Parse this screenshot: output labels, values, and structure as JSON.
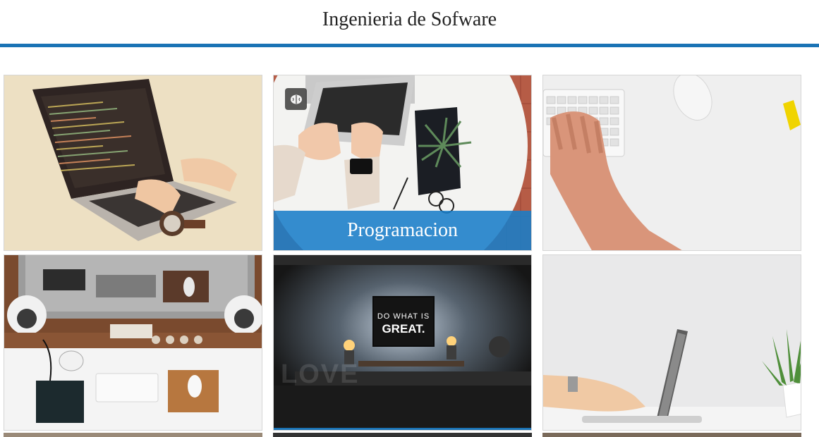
{
  "header": {
    "title": "Ingenieria de Sofware",
    "accent_color": "#1a73b5"
  },
  "gallery": {
    "cards": [
      {
        "name": "laptop-code",
        "caption": ""
      },
      {
        "name": "programacion",
        "caption": "Programacion",
        "icon": "brain-icon"
      },
      {
        "name": "white-keyboard",
        "caption": ""
      },
      {
        "name": "desk-speakers",
        "caption": ""
      },
      {
        "name": "do-what-is-great",
        "caption": "",
        "screen_text_1": "DO WHAT IS",
        "screen_text_2": "GREAT.",
        "wall_text": "LOVE"
      },
      {
        "name": "laptop-plant",
        "caption": ""
      }
    ]
  }
}
